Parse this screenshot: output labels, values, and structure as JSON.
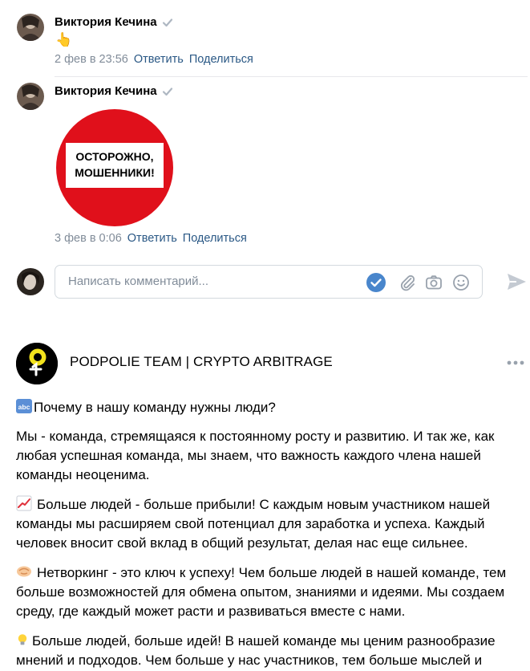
{
  "comments": [
    {
      "author": "Виктория Кечина",
      "content_emoji": "👆",
      "date": "2 фев в 23:56",
      "reply_label": "Ответить",
      "share_label": "Поделиться"
    },
    {
      "author": "Виктория Кечина",
      "sticker_line1": "ОСТОРОЖНО,",
      "sticker_line2": "МОШЕННИКИ!",
      "date": "3 фев в 0:06",
      "reply_label": "Ответить",
      "share_label": "Поделиться"
    }
  ],
  "comment_input": {
    "placeholder": "Написать комментарий..."
  },
  "post": {
    "group_name": "PODPOLIE TEAM | CRYPTO ARBITRAGE",
    "paragraphs": [
      "Почему в нашу команду нужны люди?",
      "Мы - команда, стремящаяся к постоянному росту и развитию. И так же, как любая успешная команда, мы знаем, что важность каждого члена нашей команды неоценима.",
      "Больше людей - больше прибыли! С каждым новым участником нашей команды мы расширяем свой потенциал для заработка и успеха. Каждый человек вносит свой вклад в общий результат, делая нас еще сильнее.",
      "Нетворкинг - это ключ к успеху! Чем больше людей в нашей команде, тем больше возможностей для обмена опытом, знаниями и идеями. Мы создаем среду, где каждый может расти и развиваться вместе с нами.",
      "Больше людей, больше идей! В нашей команде мы ценим разнообразие мнений и подходов. Чем больше у нас участников, тем больше мыслей и"
    ]
  },
  "colors": {
    "link": "#2a5885",
    "meta": "#818c99",
    "accent": "#4986cc",
    "stop_red": "#e0101b"
  }
}
